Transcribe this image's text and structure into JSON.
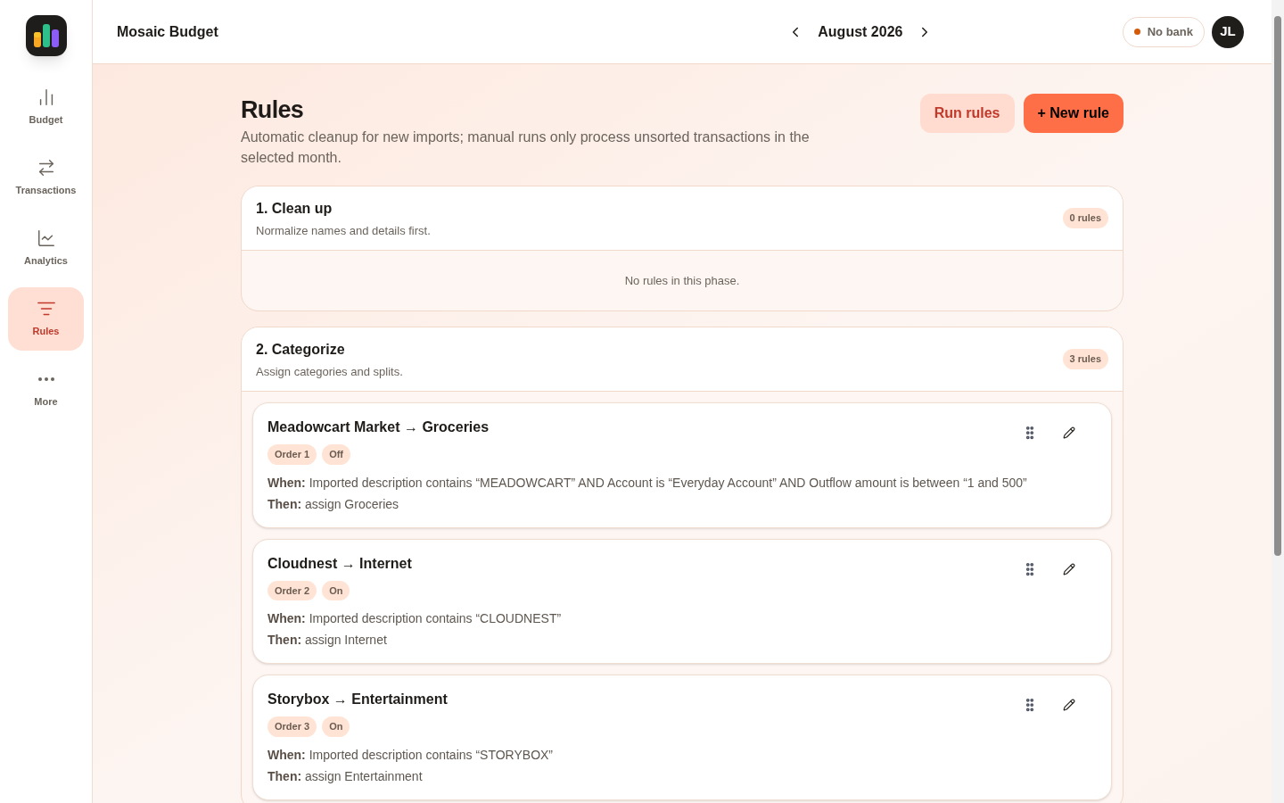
{
  "sidebar": {
    "items": [
      {
        "label": "Budget",
        "selected": false
      },
      {
        "label": "Transactions",
        "selected": false
      },
      {
        "label": "Analytics",
        "selected": false
      },
      {
        "label": "Rules",
        "selected": true
      },
      {
        "label": "More",
        "selected": false
      }
    ]
  },
  "header": {
    "app_name": "Mosaic Budget",
    "month": "August 2026",
    "bank_status": "No bank",
    "avatar": "JL"
  },
  "page": {
    "title": "Rules",
    "description": "Automatic cleanup for new imports; manual runs only process unsorted transactions in the selected month.",
    "buttons": [
      "Run rules",
      "+ New rule"
    ]
  },
  "phases": [
    {
      "title": "1. Clean up",
      "subtitle": "Normalize names and details first.",
      "count": "0 rules",
      "empty_text": "No rules in this phase."
    },
    {
      "title": "2. Categorize",
      "subtitle": "Assign categories and splits.",
      "count": "3 rules",
      "rules": [
        {
          "title": "Meadowcart Market → Groceries",
          "order": "Order 1",
          "status": "Off",
          "when_label": "When:",
          "when": "Imported description contains “MEADOWCART” AND Account is “Everyday Account” AND Outflow amount is between “1 and 500”",
          "then_label": "Then:",
          "then": "assign Groceries"
        },
        {
          "title": "Cloudnest → Internet",
          "order": "Order 2",
          "status": "On",
          "when_label": "When:",
          "when": "Imported description contains “CLOUDNEST”",
          "then_label": "Then:",
          "then": "assign Internet"
        },
        {
          "title": "Storybox → Entertainment",
          "order": "Order 3",
          "status": "On",
          "when_label": "When:",
          "when": "Imported description contains “STORYBOX”",
          "then_label": "Then:",
          "then": "assign Entertainment"
        }
      ]
    }
  ]
}
